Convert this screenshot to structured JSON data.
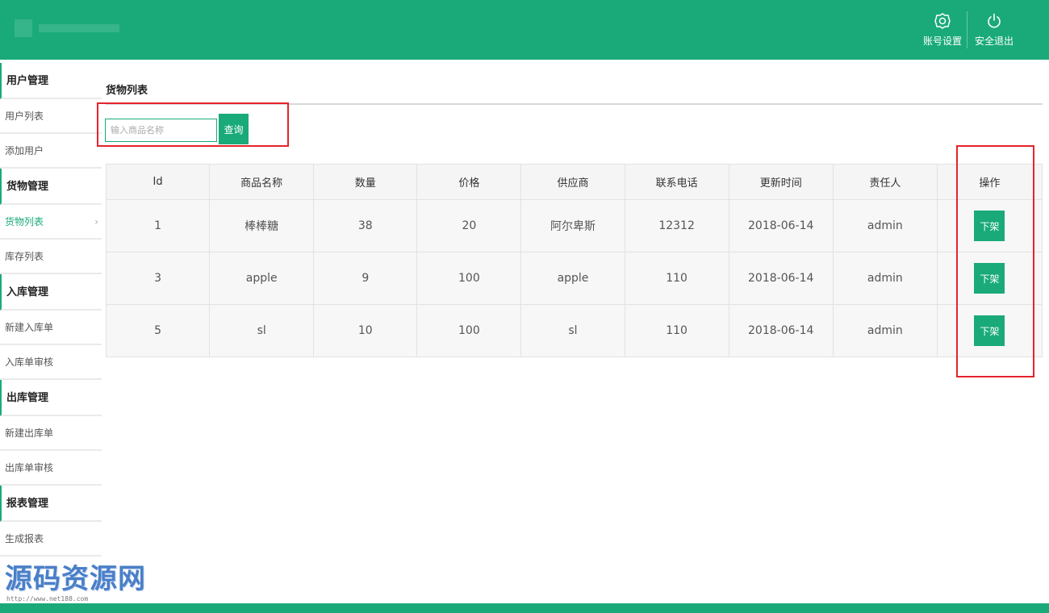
{
  "header": {
    "account_settings": "账号设置",
    "logout": "安全退出"
  },
  "sidebar": {
    "groups": [
      {
        "label": "用户管理",
        "items": [
          "用户列表",
          "添加用户"
        ]
      },
      {
        "label": "货物管理",
        "items": [
          "货物列表",
          "库存列表"
        ]
      },
      {
        "label": "入库管理",
        "items": [
          "新建入库单",
          "入库单审核"
        ]
      },
      {
        "label": "出库管理",
        "items": [
          "新建出库单",
          "出库单审核"
        ]
      },
      {
        "label": "报表管理",
        "items": [
          "生成报表"
        ]
      }
    ],
    "active_item": "货物列表"
  },
  "main": {
    "title": "货物列表",
    "search": {
      "placeholder": "输入商品名称",
      "value": "",
      "button": "查询"
    },
    "table": {
      "headers": [
        "Id",
        "商品名称",
        "数量",
        "价格",
        "供应商",
        "联系电话",
        "更新时间",
        "责任人",
        "操作"
      ],
      "rows": [
        [
          "1",
          "棒棒糖",
          "38",
          "20",
          "阿尔卑斯",
          "12312",
          "2018-06-14",
          "admin"
        ],
        [
          "3",
          "apple",
          "9",
          "100",
          "apple",
          "110",
          "2018-06-14",
          "admin"
        ],
        [
          "5",
          "sl",
          "10",
          "100",
          "sl",
          "110",
          "2018-06-14",
          "admin"
        ]
      ],
      "action_label": "下架"
    }
  },
  "watermark": {
    "text": "源码资源网",
    "url": "http://www.net188.com"
  },
  "colors": {
    "accent": "#1aaa7a",
    "highlight": "#e5232b"
  },
  "icons": {
    "settings": "gear-icon",
    "logout": "power-icon"
  }
}
